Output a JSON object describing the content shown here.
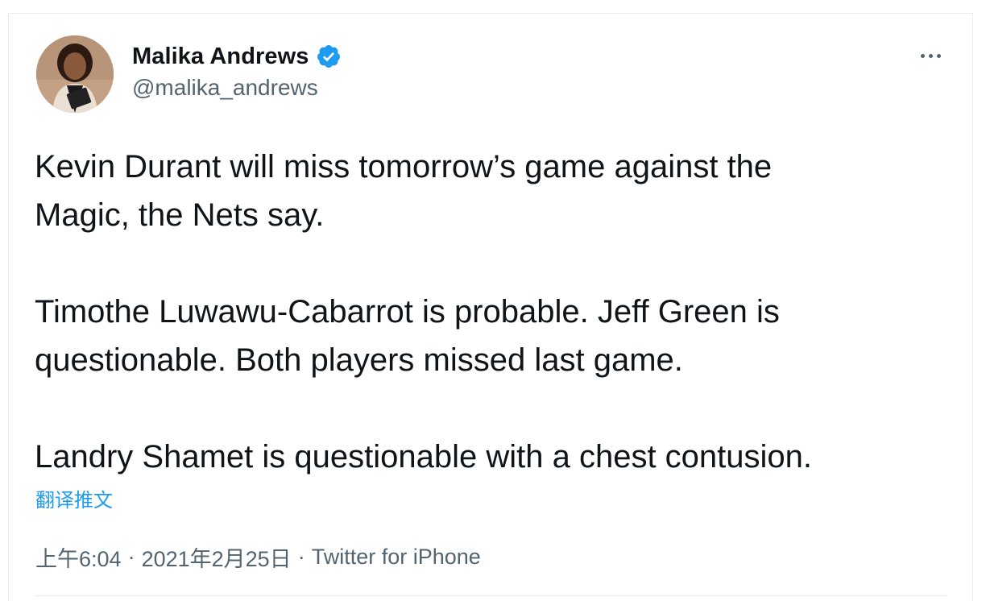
{
  "author": {
    "name": "Malika Andrews",
    "handle": "@malika_andrews",
    "verified_icon": "verified-badge-icon",
    "avatar_icon": "avatar"
  },
  "more_icon": "more-horizontal-icon",
  "tweet": {
    "text": "Kevin Durant will miss tomorrow’s game against the\nMagic, the Nets say.\n\nTimothe Luwawu-Cabarrot is probable. Jeff Green is\nquestionable. Both players missed last game.\n\nLandry Shamet is questionable with a chest contusion.",
    "translate_label": "翻译推文"
  },
  "meta": {
    "time": "上午6:04",
    "separator": "·",
    "date": "2021年2月25日",
    "source": "Twitter for iPhone"
  },
  "colors": {
    "text": "#0f1419",
    "secondary": "#536471",
    "link": "#1d9bf0",
    "verified": "#1d9bf0",
    "border": "#e6ecf0"
  }
}
